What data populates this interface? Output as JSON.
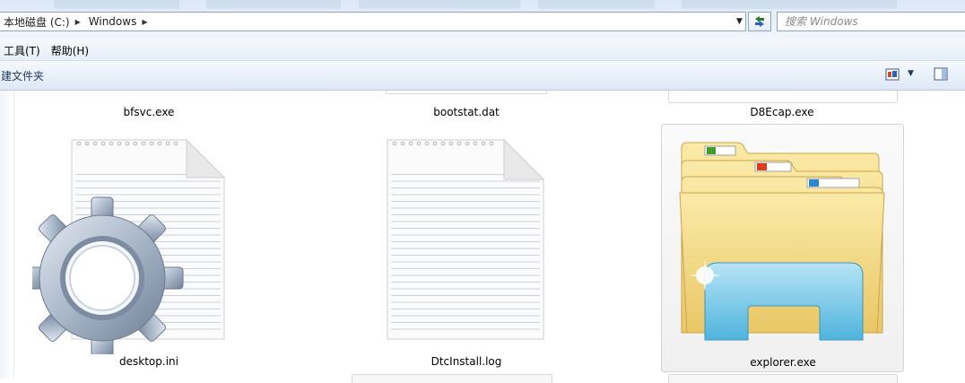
{
  "address": {
    "crumbs": [
      "本地磁盘 (C:)",
      "Windows"
    ],
    "search_placeholder": "搜索 Windows"
  },
  "menu": {
    "items": [
      "工具(T)",
      "帮助(H)"
    ]
  },
  "command_bar": {
    "new_folder_label": "建文件夹"
  },
  "files": {
    "top_row": [
      "bfsvc.exe",
      "bootstat.dat",
      "D8Ecap.exe"
    ],
    "items": [
      {
        "name": "desktop.ini",
        "icon": "settings-document-icon"
      },
      {
        "name": "DtcInstall.log",
        "icon": "text-document-icon"
      },
      {
        "name": "explorer.exe",
        "icon": "explorer-folders-icon",
        "selected": true
      }
    ]
  },
  "colors": {
    "accent": "#1e395b",
    "chrome": "#dde8f5"
  }
}
